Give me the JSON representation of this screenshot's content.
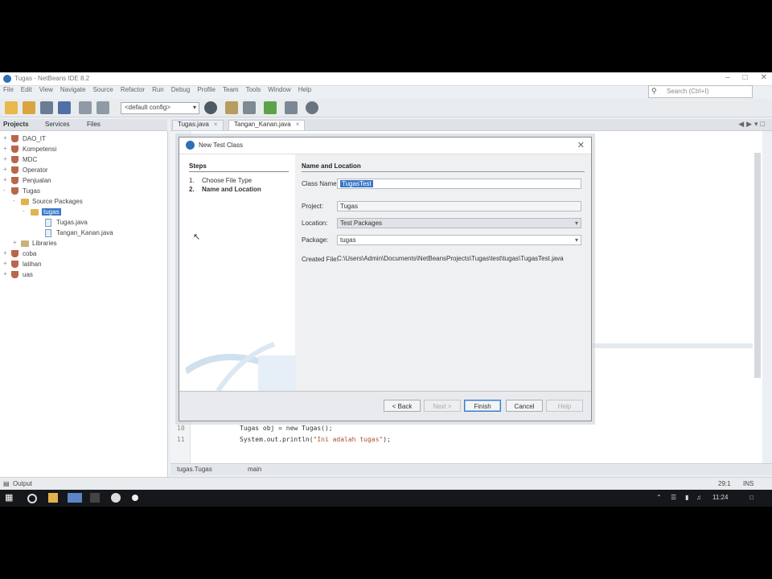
{
  "window": {
    "title": "Tugas - NetBeans IDE 8.2"
  },
  "menu": [
    "File",
    "Edit",
    "View",
    "Navigate",
    "Source",
    "Refactor",
    "Run",
    "Debug",
    "Profile",
    "Team",
    "Tools",
    "Window",
    "Help"
  ],
  "search": {
    "placeholder": "Search (Ctrl+I)"
  },
  "toolbar": {
    "config": "<default config>"
  },
  "projects_panel": {
    "tabs": [
      "Projects",
      "Services",
      "Files"
    ],
    "tree": [
      {
        "label": "DAO_IT",
        "kind": "project",
        "toggle": "+"
      },
      {
        "label": "Kompetensi",
        "kind": "project",
        "toggle": "+"
      },
      {
        "label": "MDC",
        "kind": "project",
        "toggle": "+"
      },
      {
        "label": "Operator",
        "kind": "project",
        "toggle": "+"
      },
      {
        "label": "Penjualan",
        "kind": "project",
        "toggle": "+"
      },
      {
        "label": "Tugas",
        "kind": "project",
        "toggle": "-"
      },
      {
        "label": "Source Packages",
        "kind": "folder",
        "toggle": "-"
      },
      {
        "label": "tugas",
        "kind": "package",
        "toggle": "-",
        "selected": true
      },
      {
        "label": "Tugas.java",
        "kind": "file",
        "toggle": ""
      },
      {
        "label": "Tangan_Kanan.java",
        "kind": "file",
        "toggle": ""
      },
      {
        "label": "Libraries",
        "kind": "folder",
        "toggle": "+"
      },
      {
        "label": "coba",
        "kind": "project",
        "toggle": "+"
      },
      {
        "label": "latihan",
        "kind": "project",
        "toggle": "+"
      },
      {
        "label": "uas",
        "kind": "project",
        "toggle": "+"
      }
    ]
  },
  "editor": {
    "tabs": [
      "Tugas.java",
      "Tangan_Kanan.java"
    ],
    "lines": [
      {
        "num": "10",
        "code": "Tugas obj = new Tugas();"
      },
      {
        "num": "11",
        "code": "System.out.println(",
        "str": "\"Ini adalah tugas\"",
        "end": ");"
      }
    ],
    "breadcrumb": [
      "tugas.Tugas",
      "main"
    ],
    "position": "29:1",
    "mode": "INS"
  },
  "status": {
    "output_label": "Output"
  },
  "taskbar": {
    "time": "11:24"
  },
  "dialog": {
    "title": "New Test Class",
    "steps_header": "Steps",
    "steps": [
      {
        "num": "1.",
        "label": "Choose File Type"
      },
      {
        "num": "2.",
        "label": "Name and Location"
      }
    ],
    "content_header": "Name and Location",
    "fields": {
      "class_name": {
        "label": "Class Name:",
        "value": "TugasTest"
      },
      "project": {
        "label": "Project:",
        "value": "Tugas"
      },
      "location": {
        "label": "Location:",
        "value": "Test Packages"
      },
      "package": {
        "label": "Package:",
        "value": "tugas"
      },
      "created_file": {
        "label": "Created File:",
        "value": "C:\\Users\\Admin\\Documents\\NetBeansProjects\\Tugas\\test\\tugas\\TugasTest.java"
      }
    },
    "buttons": {
      "back": "< Back",
      "next": "Next >",
      "finish": "Finish",
      "cancel": "Cancel",
      "help": "Help"
    }
  }
}
